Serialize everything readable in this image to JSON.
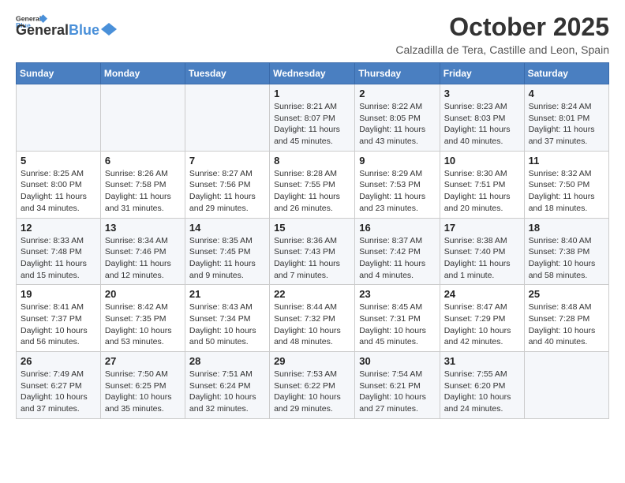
{
  "header": {
    "logo_general": "General",
    "logo_blue": "Blue",
    "month": "October 2025",
    "location": "Calzadilla de Tera, Castille and Leon, Spain"
  },
  "weekdays": [
    "Sunday",
    "Monday",
    "Tuesday",
    "Wednesday",
    "Thursday",
    "Friday",
    "Saturday"
  ],
  "weeks": [
    [
      {
        "day": "",
        "info": ""
      },
      {
        "day": "",
        "info": ""
      },
      {
        "day": "",
        "info": ""
      },
      {
        "day": "1",
        "info": "Sunrise: 8:21 AM\nSunset: 8:07 PM\nDaylight: 11 hours and 45 minutes."
      },
      {
        "day": "2",
        "info": "Sunrise: 8:22 AM\nSunset: 8:05 PM\nDaylight: 11 hours and 43 minutes."
      },
      {
        "day": "3",
        "info": "Sunrise: 8:23 AM\nSunset: 8:03 PM\nDaylight: 11 hours and 40 minutes."
      },
      {
        "day": "4",
        "info": "Sunrise: 8:24 AM\nSunset: 8:01 PM\nDaylight: 11 hours and 37 minutes."
      }
    ],
    [
      {
        "day": "5",
        "info": "Sunrise: 8:25 AM\nSunset: 8:00 PM\nDaylight: 11 hours and 34 minutes."
      },
      {
        "day": "6",
        "info": "Sunrise: 8:26 AM\nSunset: 7:58 PM\nDaylight: 11 hours and 31 minutes."
      },
      {
        "day": "7",
        "info": "Sunrise: 8:27 AM\nSunset: 7:56 PM\nDaylight: 11 hours and 29 minutes."
      },
      {
        "day": "8",
        "info": "Sunrise: 8:28 AM\nSunset: 7:55 PM\nDaylight: 11 hours and 26 minutes."
      },
      {
        "day": "9",
        "info": "Sunrise: 8:29 AM\nSunset: 7:53 PM\nDaylight: 11 hours and 23 minutes."
      },
      {
        "day": "10",
        "info": "Sunrise: 8:30 AM\nSunset: 7:51 PM\nDaylight: 11 hours and 20 minutes."
      },
      {
        "day": "11",
        "info": "Sunrise: 8:32 AM\nSunset: 7:50 PM\nDaylight: 11 hours and 18 minutes."
      }
    ],
    [
      {
        "day": "12",
        "info": "Sunrise: 8:33 AM\nSunset: 7:48 PM\nDaylight: 11 hours and 15 minutes."
      },
      {
        "day": "13",
        "info": "Sunrise: 8:34 AM\nSunset: 7:46 PM\nDaylight: 11 hours and 12 minutes."
      },
      {
        "day": "14",
        "info": "Sunrise: 8:35 AM\nSunset: 7:45 PM\nDaylight: 11 hours and 9 minutes."
      },
      {
        "day": "15",
        "info": "Sunrise: 8:36 AM\nSunset: 7:43 PM\nDaylight: 11 hours and 7 minutes."
      },
      {
        "day": "16",
        "info": "Sunrise: 8:37 AM\nSunset: 7:42 PM\nDaylight: 11 hours and 4 minutes."
      },
      {
        "day": "17",
        "info": "Sunrise: 8:38 AM\nSunset: 7:40 PM\nDaylight: 11 hours and 1 minute."
      },
      {
        "day": "18",
        "info": "Sunrise: 8:40 AM\nSunset: 7:38 PM\nDaylight: 10 hours and 58 minutes."
      }
    ],
    [
      {
        "day": "19",
        "info": "Sunrise: 8:41 AM\nSunset: 7:37 PM\nDaylight: 10 hours and 56 minutes."
      },
      {
        "day": "20",
        "info": "Sunrise: 8:42 AM\nSunset: 7:35 PM\nDaylight: 10 hours and 53 minutes."
      },
      {
        "day": "21",
        "info": "Sunrise: 8:43 AM\nSunset: 7:34 PM\nDaylight: 10 hours and 50 minutes."
      },
      {
        "day": "22",
        "info": "Sunrise: 8:44 AM\nSunset: 7:32 PM\nDaylight: 10 hours and 48 minutes."
      },
      {
        "day": "23",
        "info": "Sunrise: 8:45 AM\nSunset: 7:31 PM\nDaylight: 10 hours and 45 minutes."
      },
      {
        "day": "24",
        "info": "Sunrise: 8:47 AM\nSunset: 7:29 PM\nDaylight: 10 hours and 42 minutes."
      },
      {
        "day": "25",
        "info": "Sunrise: 8:48 AM\nSunset: 7:28 PM\nDaylight: 10 hours and 40 minutes."
      }
    ],
    [
      {
        "day": "26",
        "info": "Sunrise: 7:49 AM\nSunset: 6:27 PM\nDaylight: 10 hours and 37 minutes."
      },
      {
        "day": "27",
        "info": "Sunrise: 7:50 AM\nSunset: 6:25 PM\nDaylight: 10 hours and 35 minutes."
      },
      {
        "day": "28",
        "info": "Sunrise: 7:51 AM\nSunset: 6:24 PM\nDaylight: 10 hours and 32 minutes."
      },
      {
        "day": "29",
        "info": "Sunrise: 7:53 AM\nSunset: 6:22 PM\nDaylight: 10 hours and 29 minutes."
      },
      {
        "day": "30",
        "info": "Sunrise: 7:54 AM\nSunset: 6:21 PM\nDaylight: 10 hours and 27 minutes."
      },
      {
        "day": "31",
        "info": "Sunrise: 7:55 AM\nSunset: 6:20 PM\nDaylight: 10 hours and 24 minutes."
      },
      {
        "day": "",
        "info": ""
      }
    ]
  ]
}
